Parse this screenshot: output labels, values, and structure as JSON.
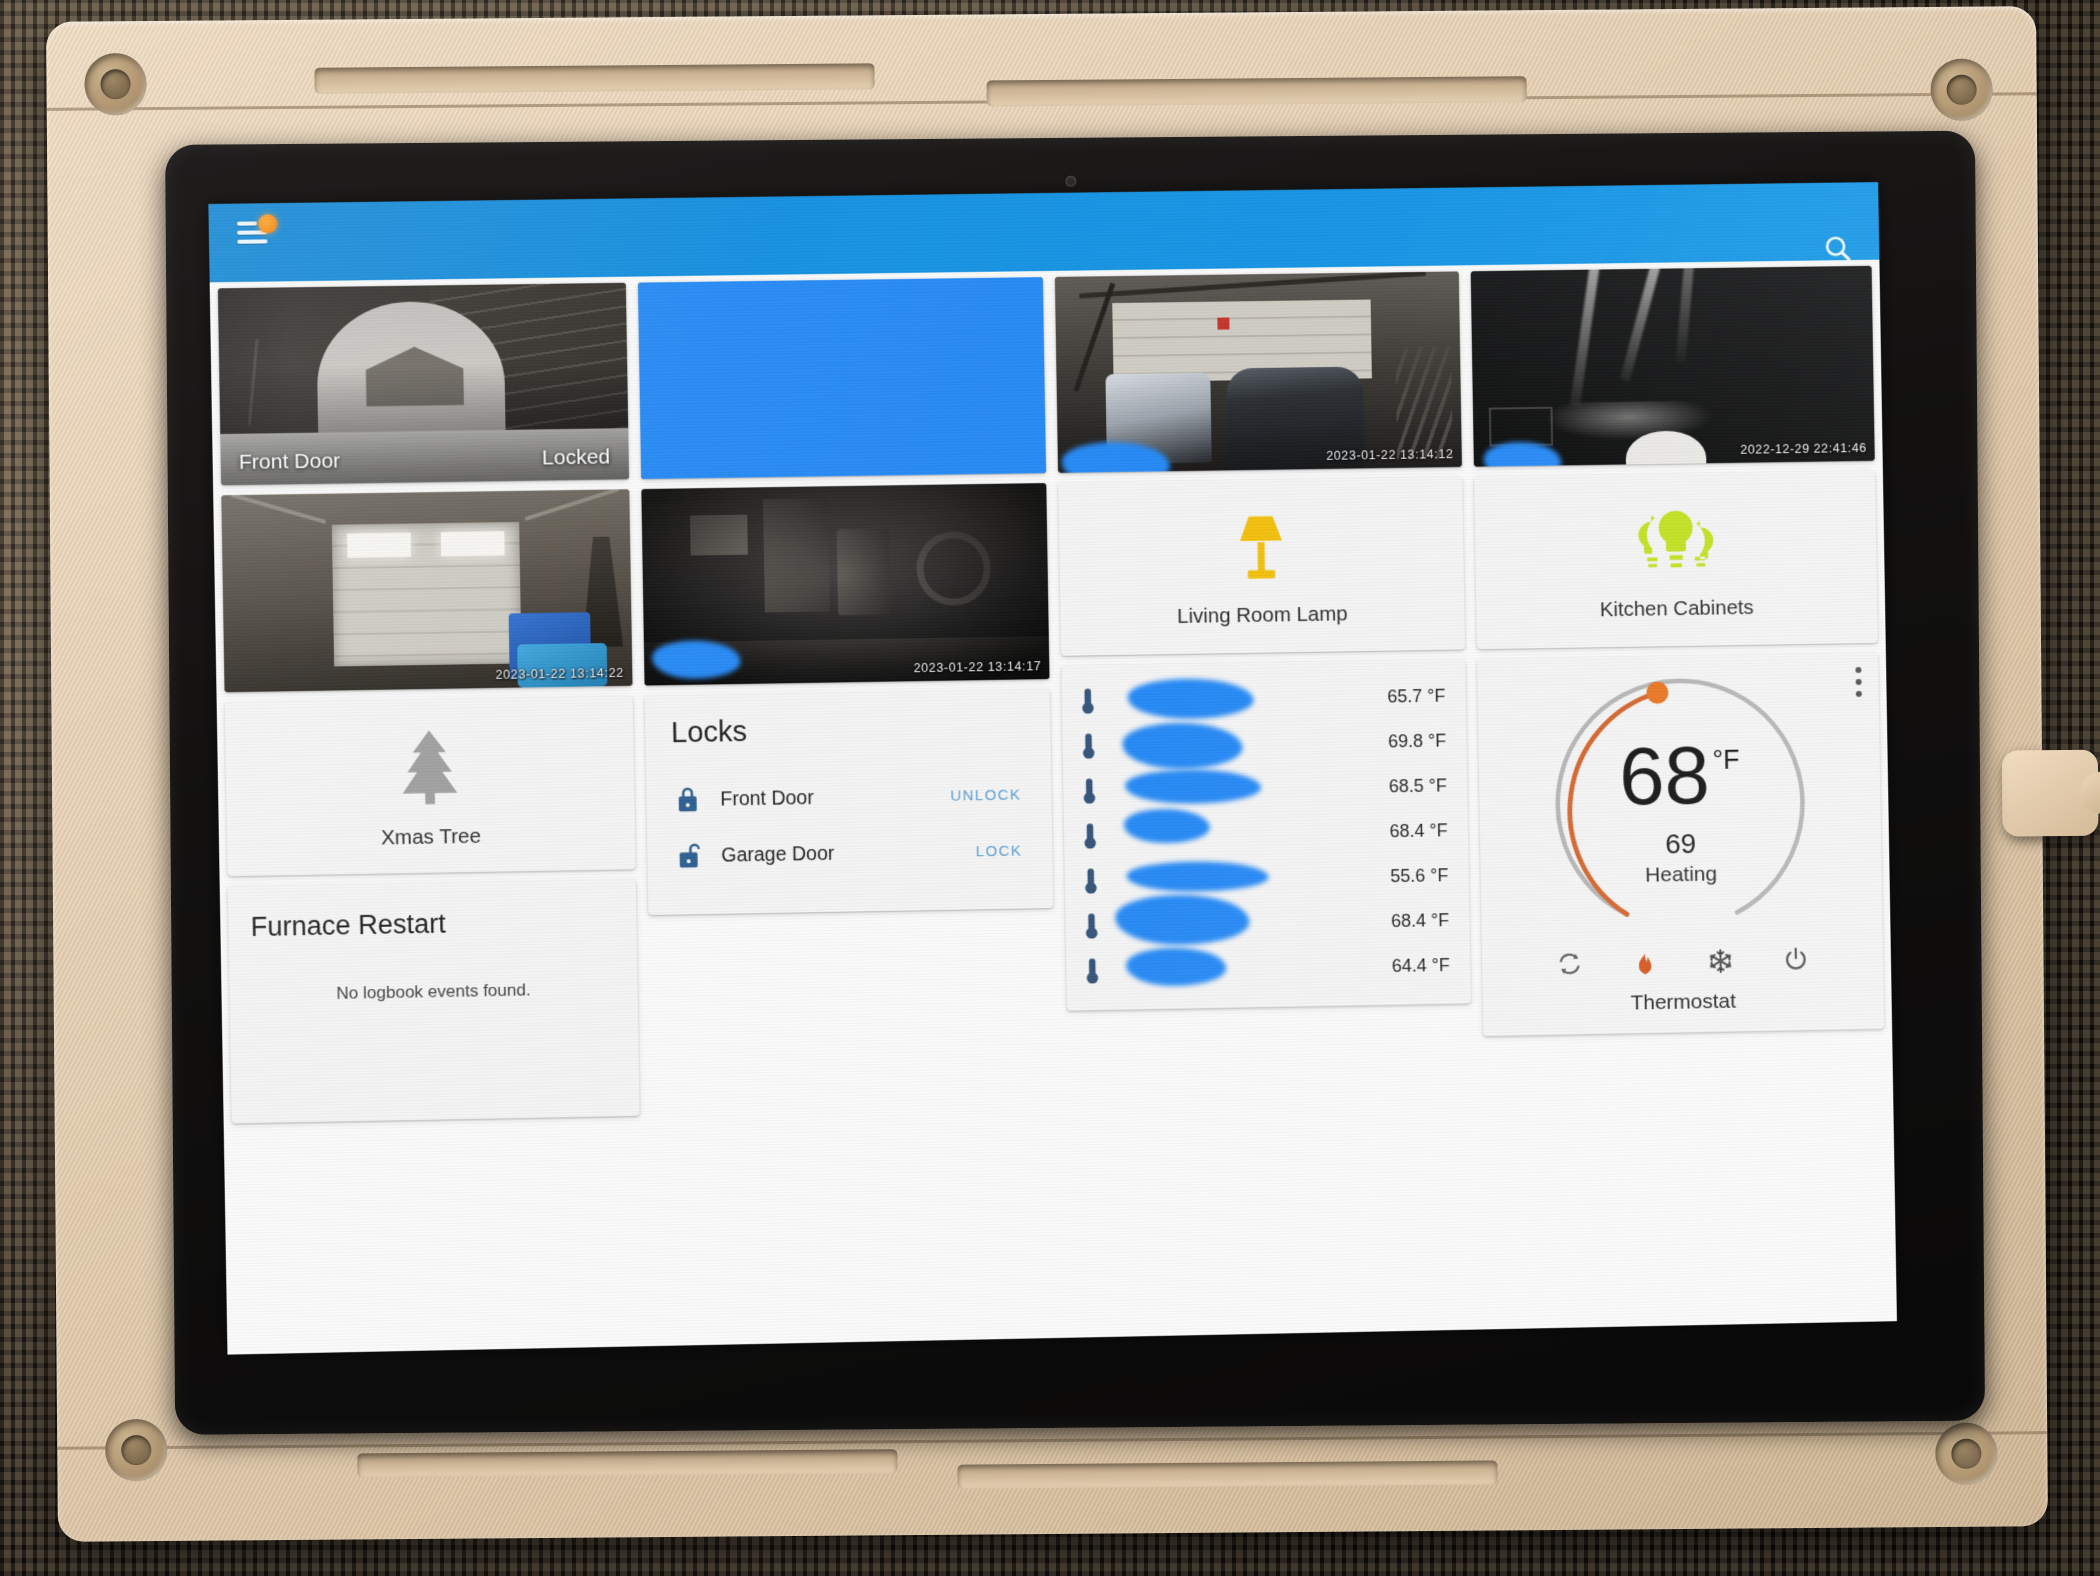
{
  "app": {
    "toolbar": {
      "menu_icon": "hamburger-menu-icon",
      "notification_badge": "notification-dot",
      "search_icon": "search-icon",
      "accent_color": "#1391e2"
    }
  },
  "cameras": [
    {
      "id": "front-door",
      "overlay_left": "Front Door",
      "overlay_right": "Locked",
      "timestamp": "",
      "redacted": false
    },
    {
      "id": "camera-redacted",
      "overlay_left": "",
      "overlay_right": "",
      "timestamp": "",
      "redacted": true
    },
    {
      "id": "garage-vehicles",
      "overlay_left": "",
      "overlay_right": "",
      "timestamp": "2023-01-22 13:14:12",
      "redacted": false
    },
    {
      "id": "backyard-night",
      "overlay_left": "",
      "overlay_right": "",
      "timestamp": "2022-12-29 22:41:46",
      "redacted": false
    },
    {
      "id": "garage-door",
      "overlay_left": "",
      "overlay_right": "",
      "timestamp": "2023-01-22 13:14:22",
      "redacted": false
    },
    {
      "id": "basement",
      "overlay_left": "",
      "overlay_right": "",
      "timestamp": "2023-01-22 13:14:17",
      "redacted": false
    }
  ],
  "lights": [
    {
      "name": "Living Room Lamp",
      "icon": "floor-lamp-icon",
      "state": "on",
      "color": "#f2c00d"
    },
    {
      "name": "Kitchen Cabinets",
      "icon": "light-group-icon",
      "state": "on",
      "color": "#c2e01e"
    }
  ],
  "switches": [
    {
      "name": "Xmas Tree",
      "icon": "pine-tree-icon",
      "state": "off",
      "color": "#9e9e9e"
    }
  ],
  "locks": {
    "title": "Locks",
    "rows": [
      {
        "name": "Front Door",
        "icon": "lock-closed-icon",
        "state": "locked",
        "action_label": "UNLOCK"
      },
      {
        "name": "Garage Door",
        "icon": "lock-open-icon",
        "state": "unlocked",
        "action_label": "LOCK"
      }
    ],
    "action_color": "#5a9fd4"
  },
  "logbook": {
    "title": "Furnace Restart",
    "empty_message": "No logbook events found."
  },
  "sensors": {
    "icon": "thermometer-icon",
    "rows": [
      {
        "name": "",
        "redacted": true,
        "value": "65.7 °F"
      },
      {
        "name": "",
        "redacted": true,
        "value": "69.8 °F"
      },
      {
        "name": "",
        "redacted": true,
        "value": "68.5 °F"
      },
      {
        "name": "",
        "redacted": true,
        "value": "68.4 °F"
      },
      {
        "name": "",
        "redacted": true,
        "value": "55.6 °F"
      },
      {
        "name": "",
        "redacted": true,
        "value": "68.4 °F"
      },
      {
        "name": "",
        "redacted": true,
        "value": "64.4 °F"
      }
    ]
  },
  "thermostat": {
    "name": "Thermostat",
    "current_temperature": "68",
    "unit": "°F",
    "target_temperature": "69",
    "hvac_action": "Heating",
    "active_mode": "heat",
    "arc_color": "#d4622a",
    "track_color": "#b4b4b4",
    "overflow_menu": "overflow-menu-icon",
    "modes": [
      {
        "id": "auto",
        "icon": "auto-mode-icon",
        "active": false
      },
      {
        "id": "heat",
        "icon": "flame-icon",
        "active": true
      },
      {
        "id": "cool",
        "icon": "snowflake-icon",
        "active": false
      },
      {
        "id": "off",
        "icon": "power-icon",
        "active": false
      }
    ]
  },
  "redaction": {
    "color": "#2589f5"
  }
}
